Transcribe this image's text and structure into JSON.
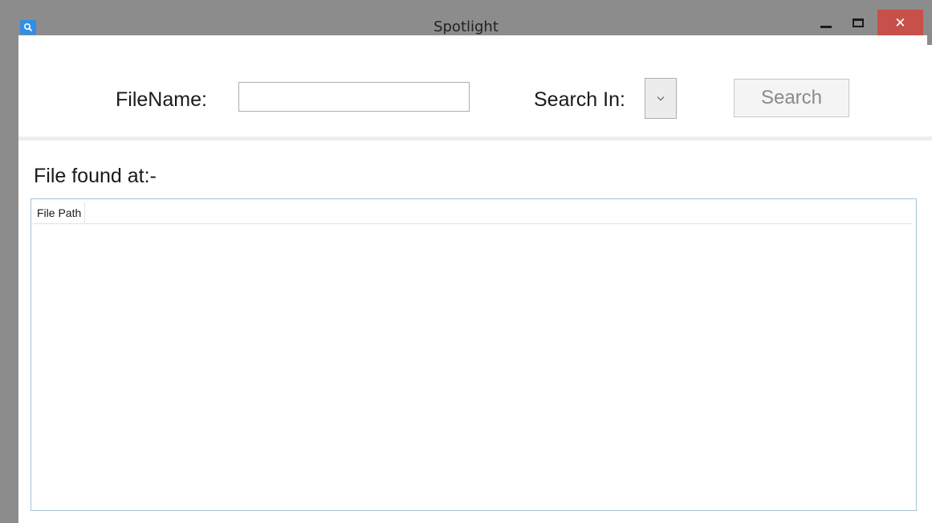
{
  "window": {
    "title": "Spotlight",
    "icon": "search-icon",
    "controls": {
      "minimize": "minimize-icon",
      "maximize": "maximize-icon",
      "close_glyph": "✕"
    }
  },
  "toolbar": {
    "filename_label": "FileName:",
    "filename_value": "",
    "search_in_label": "Search In:",
    "search_in_selected": "",
    "search_button": "Search"
  },
  "results": {
    "label": "File found at:-",
    "columns": [
      "File Path"
    ],
    "rows": []
  },
  "colors": {
    "chrome": "#8c8c8c",
    "close_button": "#c7504a",
    "grid_border": "#a6c4d6"
  }
}
